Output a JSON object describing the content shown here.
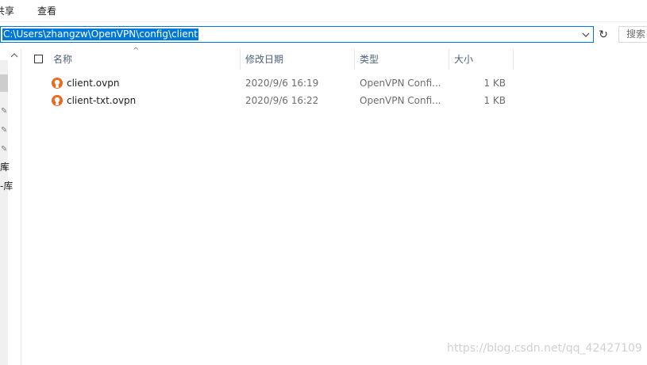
{
  "ribbon": {
    "tabs": [
      {
        "label": "共享"
      },
      {
        "label": "查看"
      }
    ]
  },
  "address": {
    "path": "C:\\Users\\zhangzw\\OpenVPN\\config\\client",
    "refresh_glyph": "↻",
    "search_placeholder": "搜索"
  },
  "nav": {
    "fragments": [
      "库",
      "-库"
    ]
  },
  "columns": {
    "name": "名称",
    "date": "修改日期",
    "type": "类型",
    "size": "大小",
    "sort_glyph": "^"
  },
  "files": [
    {
      "name": "client.ovpn",
      "date": "2020/9/6 16:19",
      "type": "OpenVPN Confi...",
      "size": "1 KB",
      "icon": "openvpn-icon"
    },
    {
      "name": "client-txt.ovpn",
      "date": "2020/9/6 16:22",
      "type": "OpenVPN Confi...",
      "size": "1 KB",
      "icon": "openvpn-icon"
    }
  ],
  "watermark": "https://blog.csdn.net/qq_42427109",
  "colors": {
    "accent": "#0078d7",
    "openvpn_orange": "#e96b1f"
  }
}
